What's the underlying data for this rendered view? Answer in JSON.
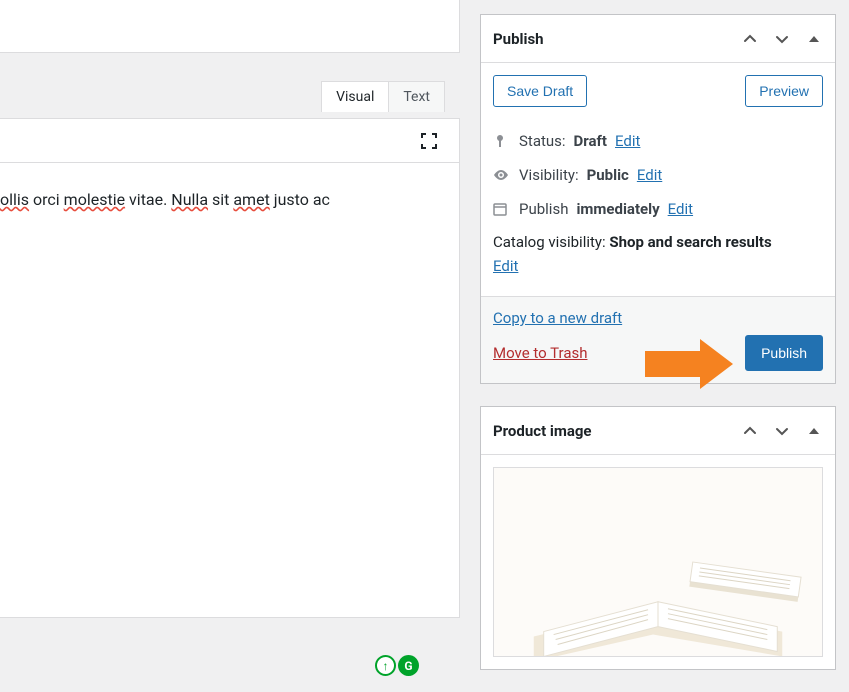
{
  "editor": {
    "tabs": {
      "visual": "Visual",
      "text": "Text"
    },
    "content_prefix": "ollis",
    "content_mid1": " orci ",
    "content_err1": "molestie",
    "content_mid2": " vitae. ",
    "content_err2": "Nulla",
    "content_mid3": " sit ",
    "content_err3": "amet",
    "content_mid4": " justo ac"
  },
  "publish": {
    "title": "Publish",
    "save_draft": "Save Draft",
    "preview": "Preview",
    "status_label": "Status: ",
    "status_value": "Draft",
    "visibility_label": "Visibility: ",
    "visibility_value": "Public",
    "publish_label": "Publish ",
    "publish_value": "immediately",
    "catalog_label": "Catalog visibility: ",
    "catalog_value": "Shop and search results",
    "edit": "Edit",
    "copy_draft": "Copy to a new draft",
    "move_trash": "Move to Trash",
    "publish_btn": "Publish"
  },
  "product_image": {
    "title": "Product image"
  }
}
